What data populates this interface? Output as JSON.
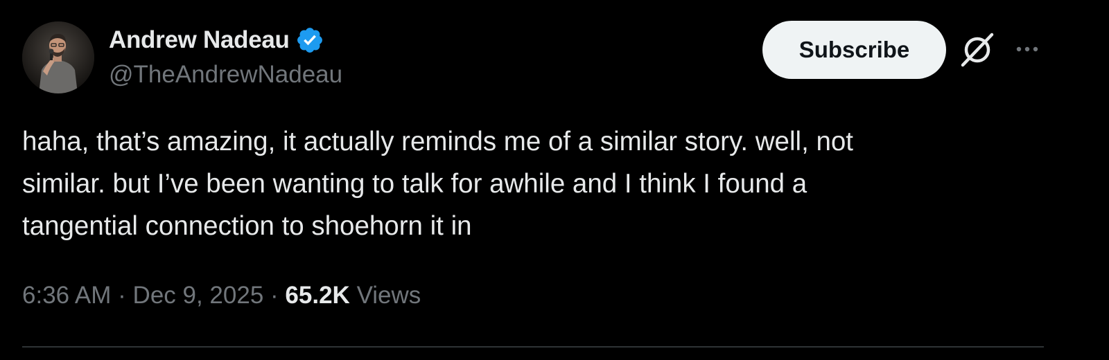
{
  "author": {
    "display_name": "Andrew Nadeau",
    "handle": "@TheAndrewNadeau",
    "verified": true,
    "avatar_icon": "comedian-with-microphone-photo"
  },
  "actions": {
    "subscribe_label": "Subscribe",
    "grok_icon": "grok-slash-icon",
    "more_icon": "more-horizontal-icon"
  },
  "tweet": {
    "text": "haha, that’s amazing, it actually reminds me of a similar story. well, not\nsimilar. but I’ve been wanting to talk for awhile and I think I found a\ntangential connection to shoehorn it in",
    "time": "6:36 AM",
    "separator": "·",
    "date": "Dec 9, 2025",
    "views_count": "65.2K",
    "views_label": "Views"
  },
  "colors": {
    "background": "#000000",
    "text_primary": "#e7e9ea",
    "text_secondary": "#71767b",
    "verified_blue": "#1d9bf0",
    "button_bg": "#eff3f4",
    "divider": "#2f3336"
  }
}
